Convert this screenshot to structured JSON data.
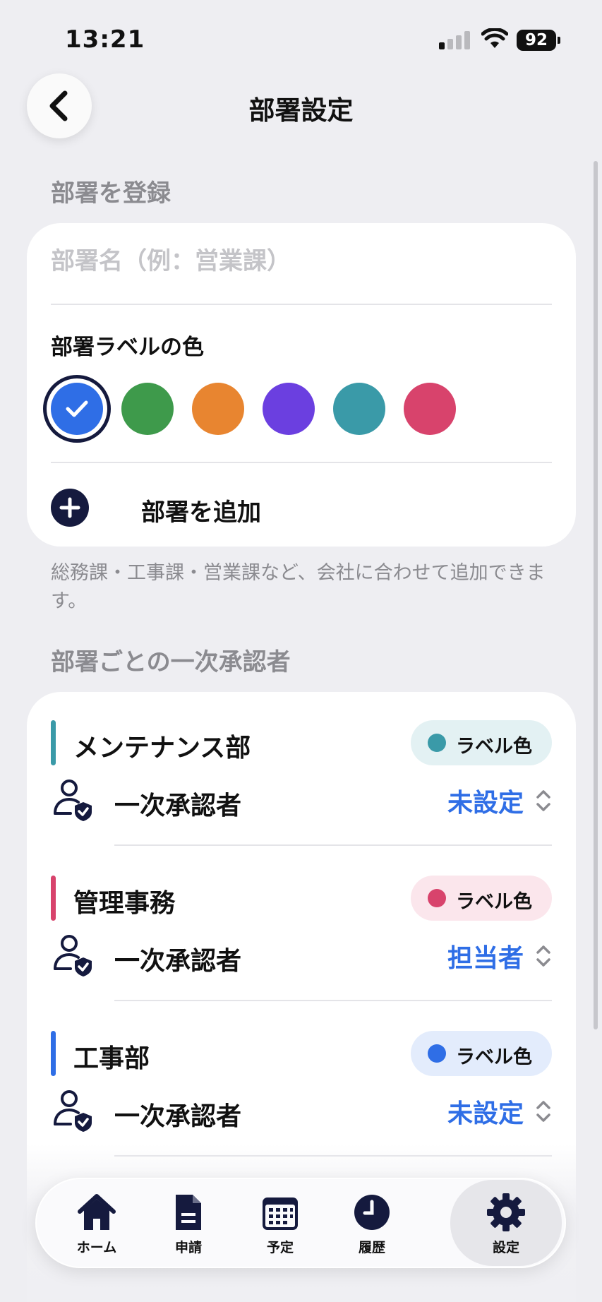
{
  "status_bar": {
    "time": "13:21",
    "battery": "92"
  },
  "header": {
    "title": "部署設定"
  },
  "register_section": {
    "heading": "部署を登録",
    "name_placeholder": "部署名（例：営業課）",
    "color_label": "部署ラベルの色",
    "colors": [
      "#2f6ee6",
      "#3e9a4b",
      "#e88530",
      "#6b3fe0",
      "#3a9aa8",
      "#d8436c"
    ],
    "selected_color": "#2f6ee6",
    "add_label": "部署を追加",
    "helper_text": "総務課・工事課・営業課など、会社に合わせて追加できます。"
  },
  "approver_section": {
    "heading": "部署ごとの一次承認者",
    "departments": [
      {
        "name": "メンテナンス部",
        "badge": "ラベル色",
        "color": "#3a9aa8",
        "badge_bg": "#e3f1f3",
        "approver_label": "一次承認者",
        "approver_value": "未設定"
      },
      {
        "name": "管理事務",
        "badge": "ラベル色",
        "color": "#d8436c",
        "badge_bg": "#fbe6ec",
        "approver_label": "一次承認者",
        "approver_value": "担当者"
      },
      {
        "name": "工事部",
        "badge": "ラベル色",
        "color": "#2f6ee6",
        "badge_bg": "#e3ecfc",
        "approver_label": "一次承認者",
        "approver_value": "未設定"
      }
    ]
  },
  "tab_bar": {
    "tabs": [
      {
        "label": "ホーム",
        "icon": "home-icon"
      },
      {
        "label": "申請",
        "icon": "document-icon"
      },
      {
        "label": "予定",
        "icon": "calendar-icon"
      },
      {
        "label": "履歴",
        "icon": "clock-icon"
      },
      {
        "label": "設定",
        "icon": "gear-icon"
      }
    ],
    "active": "設定"
  }
}
